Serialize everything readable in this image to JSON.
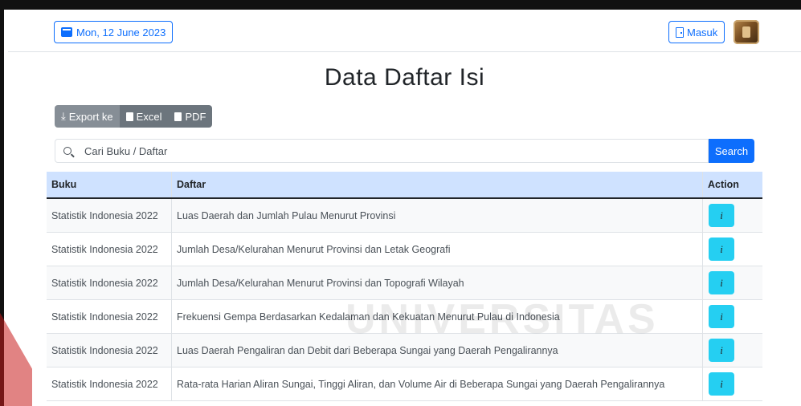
{
  "header": {
    "date_label": "Mon, 12 June 2023",
    "login_label": "Masuk"
  },
  "main": {
    "title": "Data Daftar Isi",
    "export": {
      "label": "Export ke",
      "excel_label": "Excel",
      "pdf_label": "PDF"
    },
    "search": {
      "placeholder": "Cari Buku / Daftar",
      "button_label": "Search"
    },
    "table": {
      "headers": [
        "Buku",
        "Daftar",
        "Action"
      ],
      "action_label": "i",
      "rows": [
        {
          "buku": "Statistik Indonesia 2022",
          "daftar": "Luas Daerah dan Jumlah Pulau Menurut Provinsi"
        },
        {
          "buku": "Statistik Indonesia 2022",
          "daftar": "Jumlah Desa/Kelurahan Menurut Provinsi dan Letak Geografi"
        },
        {
          "buku": "Statistik Indonesia 2022",
          "daftar": "Jumlah Desa/Kelurahan Menurut Provinsi dan Topografi Wilayah"
        },
        {
          "buku": "Statistik Indonesia 2022",
          "daftar": "Frekuensi Gempa Berdasarkan Kedalaman dan Kekuatan Menurut Pulau di Indonesia"
        },
        {
          "buku": "Statistik Indonesia 2022",
          "daftar": "Luas Daerah Pengaliran dan Debit dari Beberapa Sungai yang Daerah Pengalirannya"
        },
        {
          "buku": "Statistik Indonesia 2022",
          "daftar": "Rata-rata Harian Aliran Sungai, Tinggi Aliran, dan Volume Air di Beberapa Sungai yang Daerah Pengalirannya"
        }
      ]
    }
  },
  "watermark": {
    "text": "UNIVERSITAS"
  },
  "colors": {
    "primary": "#0d6efd",
    "info": "#25cff2",
    "table_header_bg": "#cfe2ff",
    "export_bg": "#6c757d"
  }
}
